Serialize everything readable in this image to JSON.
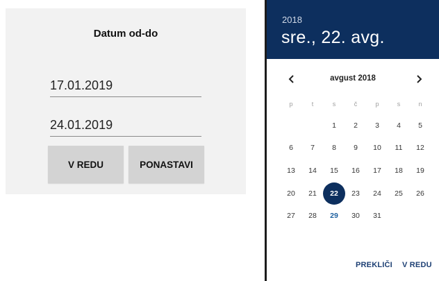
{
  "range_dialog": {
    "title": "Datum od-do",
    "date_from": "17.01.2019",
    "date_to": "24.01.2019",
    "ok_label": "V REDU",
    "reset_label": "PONASTAVI"
  },
  "date_picker": {
    "year": "2018",
    "selected_date_label": "sre., 22. avg.",
    "month_label": "avgust 2018",
    "prev_icon": "chevron-left-icon",
    "next_icon": "chevron-right-icon",
    "weekdays": [
      "p",
      "t",
      "s",
      "č",
      "p",
      "s",
      "n"
    ],
    "weeks": [
      [
        "",
        "",
        "1",
        "2",
        "3",
        "4",
        "5"
      ],
      [
        "6",
        "7",
        "8",
        "9",
        "10",
        "11",
        "12"
      ],
      [
        "13",
        "14",
        "15",
        "16",
        "17",
        "18",
        "19"
      ],
      [
        "20",
        "21",
        "22",
        "23",
        "24",
        "25",
        "26"
      ],
      [
        "27",
        "28",
        "29",
        "30",
        "31",
        "",
        ""
      ]
    ],
    "selected_day": "22",
    "today_day": "29",
    "cancel_label": "PREKLIČI",
    "ok_label": "V REDU",
    "colors": {
      "header_bg": "#0d2f5e",
      "accent": "#1d3f73",
      "selected_bg": "#0d2f5e"
    }
  }
}
